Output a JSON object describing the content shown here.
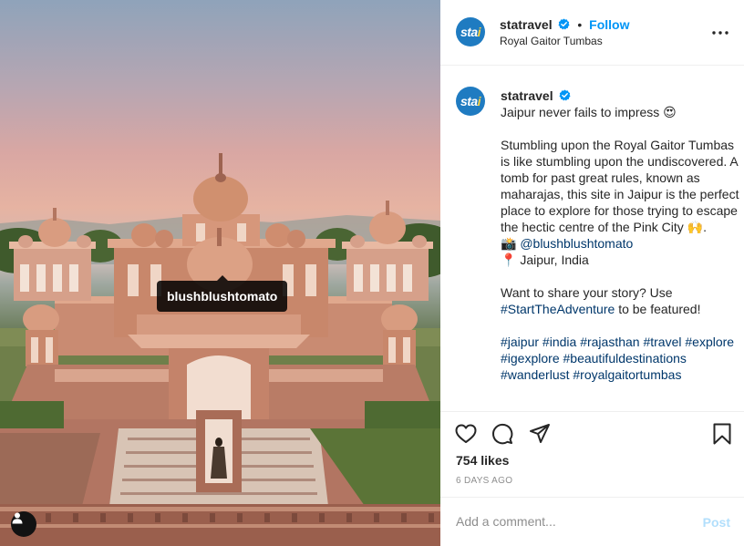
{
  "photo": {
    "tagged_user": "blushblushtomato",
    "tag_icon": "user-icon"
  },
  "header": {
    "username": "statravel",
    "separator": "•",
    "follow_label": "Follow",
    "location": "Royal Gaitor Tumbas",
    "avatar_text": "sta",
    "avatar_dot": "i",
    "more_icon": "more-horizontal-icon",
    "verified_icon": "verified-badge-icon"
  },
  "caption": {
    "username": "statravel",
    "line1": "Jaipur never fails to impress 😍",
    "para2": "Stumbling upon the Royal Gaitor Tumbas is like stumbling upon the undiscovered. A tomb for past great rules, known as maharajas, this site in Jaipur is the perfect place to explore for those trying to escape the hectic centre of the Pink City 🙌.",
    "camera_emoji": "📸",
    "credit_handle": "@blushblushtomato",
    "pin_emoji": "📍",
    "place": "Jaipur, India",
    "share_text": "Want to share your story? Use",
    "share_tag": "#StartTheAdventure",
    "share_suffix": "to be featured!",
    "hashtags": [
      "#jaipur",
      "#india",
      "#rajasthan",
      "#travel",
      "#explore",
      "#igexplore",
      "#beautifuldestinations",
      "#wanderlust",
      "#royalgaitortumbas"
    ]
  },
  "actions": {
    "like_icon": "heart-icon",
    "comment_icon": "comment-icon",
    "share_icon": "paper-plane-icon",
    "save_icon": "bookmark-icon",
    "likes": "754 likes",
    "date": "6 DAYS AGO"
  },
  "comment": {
    "placeholder": "Add a comment...",
    "post_label": "Post"
  },
  "colors": {
    "accent": "#0095f6",
    "link": "#00376b",
    "post_disabled": "#b2dffc",
    "avatar": "#1f7bc1"
  }
}
